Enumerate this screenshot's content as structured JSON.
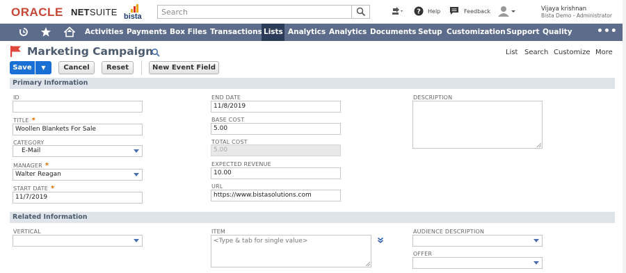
{
  "header": {
    "logo_oracle": "ORACLE",
    "logo_netsuite_bold": "NET",
    "logo_netsuite_rest": "SUITE",
    "logo_bista": "bista",
    "search_placeholder": "Search",
    "help_label": "Help",
    "feedback_label": "Feedback",
    "user_name": "Vijaya krishnan",
    "user_role": "Bista Demo - Administrator"
  },
  "nav": {
    "items": [
      {
        "label": "Activities"
      },
      {
        "label": "Payments"
      },
      {
        "label": "Box Files"
      },
      {
        "label": "Transactions"
      },
      {
        "label": "Lists"
      },
      {
        "label": "Analytics"
      },
      {
        "label": "Analytics"
      },
      {
        "label": "Documents"
      },
      {
        "label": "Setup"
      },
      {
        "label": "Customization"
      },
      {
        "label": "Support"
      },
      {
        "label": "Quality"
      }
    ],
    "active": "Lists",
    "more": "•••"
  },
  "page": {
    "title": "Marketing Campaign",
    "links": [
      "List",
      "Search",
      "Customize",
      "More"
    ]
  },
  "toolbar": {
    "save": "Save",
    "cancel": "Cancel",
    "reset": "Reset",
    "new_event_field": "New Event Field"
  },
  "primary": {
    "section_title": "Primary Information",
    "id_label": "ID",
    "id_value": "",
    "title_label": "TITLE",
    "title_value": "Woollen Blankets For Sale",
    "category_label": "CATEGORY",
    "category_value": "E-Mail",
    "manager_label": "MANAGER",
    "manager_value": "Walter Reagan",
    "start_date_label": "START DATE",
    "start_date_value": "11/7/2019",
    "end_date_label": "END DATE",
    "end_date_value": "11/8/2019",
    "base_cost_label": "BASE COST",
    "base_cost_value": "5.00",
    "total_cost_label": "TOTAL COST",
    "total_cost_value": "5.00",
    "expected_revenue_label": "EXPECTED REVENUE",
    "expected_revenue_value": "10.00",
    "url_label": "URL",
    "url_value": "https://www.bistasolutions.com",
    "description_label": "DESCRIPTION",
    "description_value": ""
  },
  "related": {
    "section_title": "Related Information",
    "vertical_label": "VERTICAL",
    "vertical_value": "",
    "item_label": "ITEM",
    "item_placeholder": "<Type & tab for single value>",
    "audience_label": "AUDIENCE DESCRIPTION",
    "audience_value": "",
    "offer_label": "OFFER",
    "offer_value": ""
  },
  "required_marker": "*",
  "colors": {
    "navbar": "#5c6c8a",
    "nav_active": "#2b3b58",
    "save_button": "#1a6fd4",
    "section_bar": "#dfe4eb",
    "oracle_red": "#c74634",
    "required": "#e06c00"
  }
}
